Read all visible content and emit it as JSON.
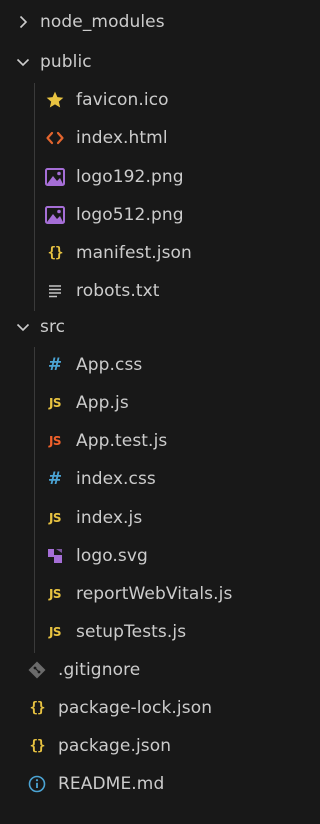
{
  "explorer": {
    "items": [
      {
        "name": "node_modules",
        "kind": "folder",
        "state": "collapsed",
        "icon": "chevron-right-icon"
      },
      {
        "name": "public",
        "kind": "folder",
        "state": "expanded",
        "icon": "chevron-down-icon"
      },
      {
        "name": "favicon.ico",
        "kind": "file",
        "icon": "star-icon",
        "color": "#e8c341"
      },
      {
        "name": "index.html",
        "kind": "file",
        "icon": "html-angle-brackets-icon",
        "color": "#e3652e"
      },
      {
        "name": "logo192.png",
        "kind": "file",
        "icon": "image-icon",
        "color": "#a56ed6"
      },
      {
        "name": "logo512.png",
        "kind": "file",
        "icon": "image-icon",
        "color": "#a56ed6"
      },
      {
        "name": "manifest.json",
        "kind": "file",
        "icon": "json-braces-icon",
        "glyph": "{}",
        "color": "#e8c341"
      },
      {
        "name": "robots.txt",
        "kind": "file",
        "icon": "text-lines-icon",
        "color": "#c5c5c5"
      },
      {
        "name": "src",
        "kind": "folder",
        "state": "expanded",
        "icon": "chevron-down-icon"
      },
      {
        "name": "App.css",
        "kind": "file",
        "icon": "css-hash-icon",
        "glyph": "#",
        "color": "#4ba4d4"
      },
      {
        "name": "App.js",
        "kind": "file",
        "icon": "javascript-icon",
        "glyph": "JS",
        "color": "#e8c341"
      },
      {
        "name": "App.test.js",
        "kind": "file",
        "icon": "javascript-test-icon",
        "glyph": "JS",
        "color": "#f0612b"
      },
      {
        "name": "index.css",
        "kind": "file",
        "icon": "css-hash-icon",
        "glyph": "#",
        "color": "#4ba4d4"
      },
      {
        "name": "index.js",
        "kind": "file",
        "icon": "javascript-icon",
        "glyph": "JS",
        "color": "#e8c341"
      },
      {
        "name": "logo.svg",
        "kind": "file",
        "icon": "svg-icon",
        "color": "#a56ed6"
      },
      {
        "name": "reportWebVitals.js",
        "kind": "file",
        "icon": "javascript-icon",
        "glyph": "JS",
        "color": "#e8c341"
      },
      {
        "name": "setupTests.js",
        "kind": "file",
        "icon": "javascript-icon",
        "glyph": "JS",
        "color": "#e8c341"
      },
      {
        "name": ".gitignore",
        "kind": "file",
        "icon": "git-diamond-icon",
        "color": "#6b6b6b"
      },
      {
        "name": "package-lock.json",
        "kind": "file",
        "icon": "json-braces-icon",
        "glyph": "{}",
        "color": "#e8c341"
      },
      {
        "name": "package.json",
        "kind": "file",
        "icon": "json-braces-icon",
        "glyph": "{}",
        "color": "#e8c341"
      },
      {
        "name": "README.md",
        "kind": "file",
        "icon": "info-icon",
        "color": "#4ba4d4"
      }
    ]
  }
}
